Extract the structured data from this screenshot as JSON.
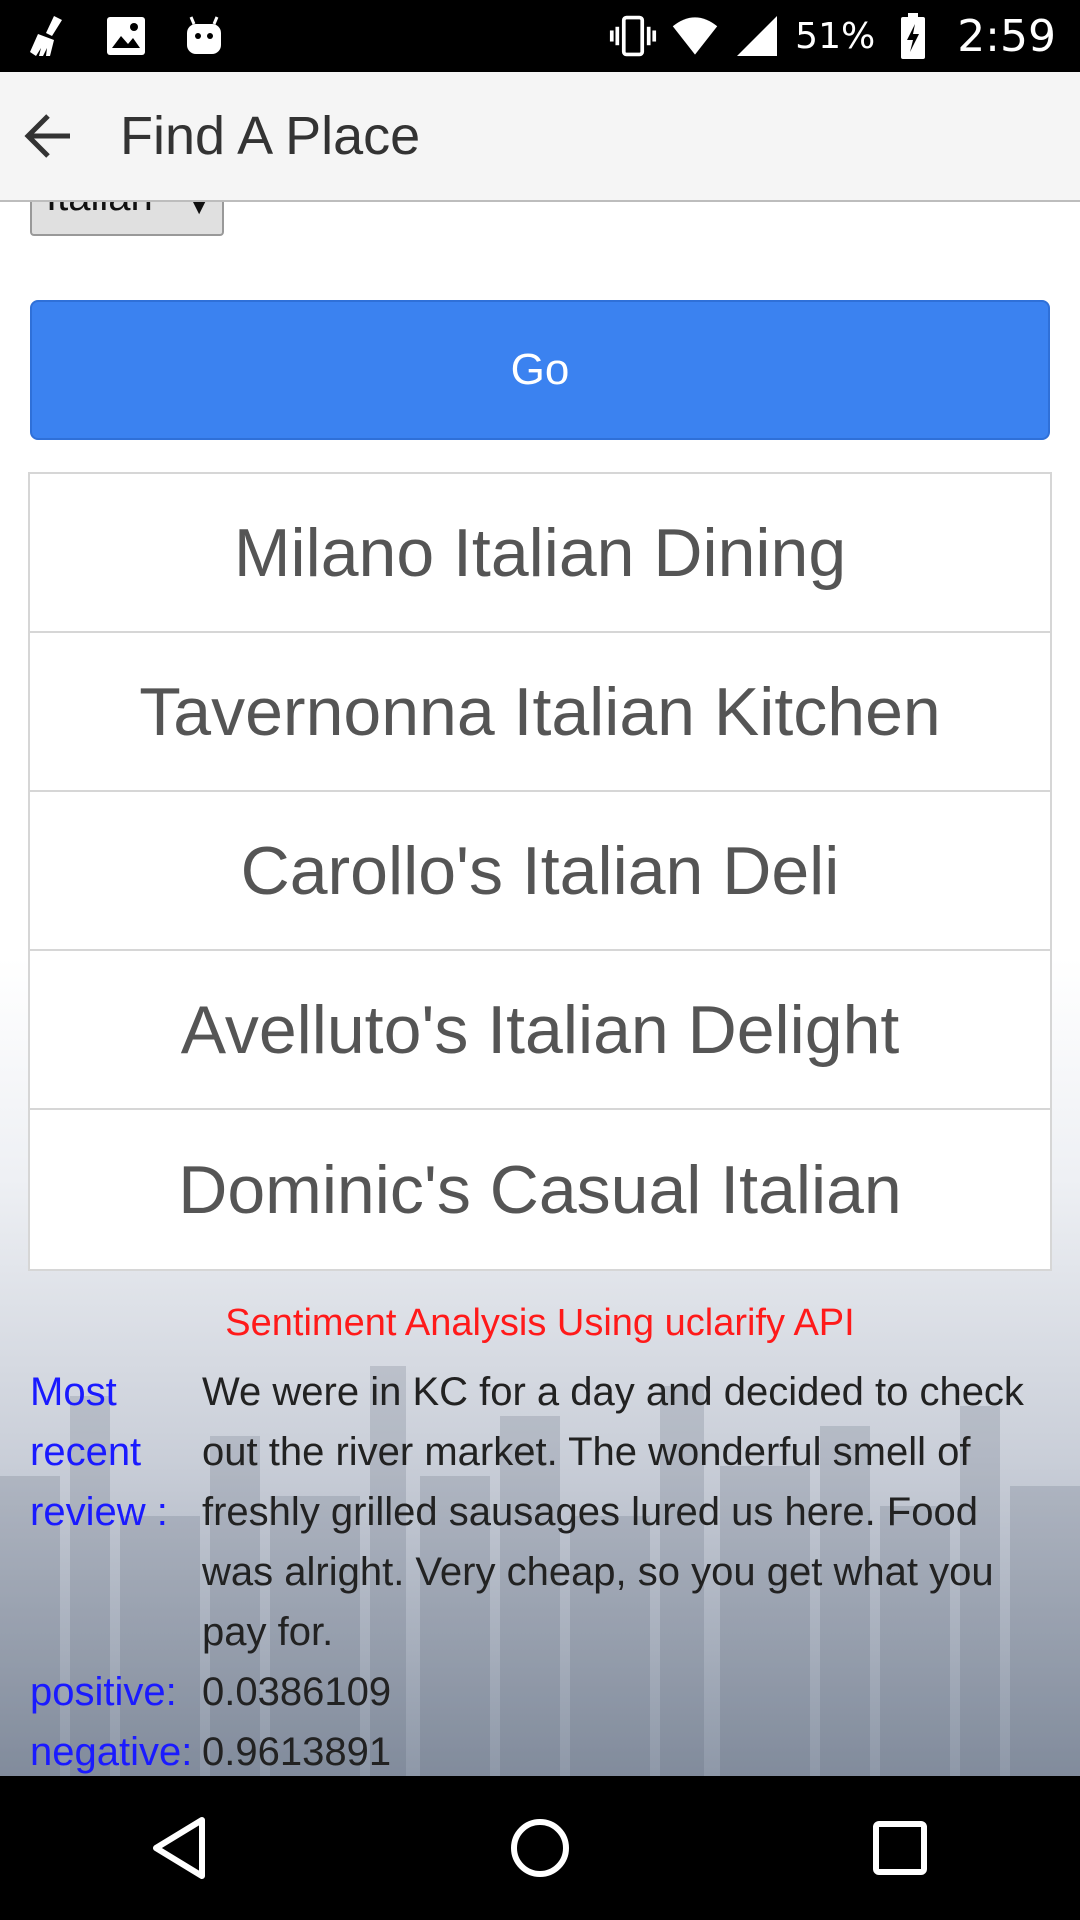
{
  "status_bar": {
    "battery": "51%",
    "time": "2:59",
    "icons": [
      "broom-icon",
      "image-icon",
      "android-icon",
      "vibrate-icon",
      "wifi-icon",
      "signal-icon",
      "battery-charging-icon"
    ]
  },
  "app_bar": {
    "title": "Find A Place"
  },
  "filter": {
    "selected": "Italian"
  },
  "go_button": {
    "label": "Go"
  },
  "results": [
    "Milano Italian Dining",
    "Tavernonna Italian Kitchen",
    "Carollo's Italian Deli",
    "Avelluto's Italian Delight",
    "Dominic's Casual Italian"
  ],
  "sentiment": {
    "title": "Sentiment Analysis Using uclarify API",
    "review_label": "Most recent review :",
    "review_text": "We were in KC for a day and decided to check out the river market. The wonderful smell of freshly grilled sausages lured us here. Food was alright. Very cheap, so you get what you pay for.",
    "positive_label": "positive:",
    "positive_value": "0.0386109",
    "negative_label": "negative:",
    "negative_value": "0.9613891"
  },
  "colors": {
    "accent": "#3b82f0",
    "sentiment_title": "#ff1a1a",
    "label_blue": "#1a1aff"
  }
}
